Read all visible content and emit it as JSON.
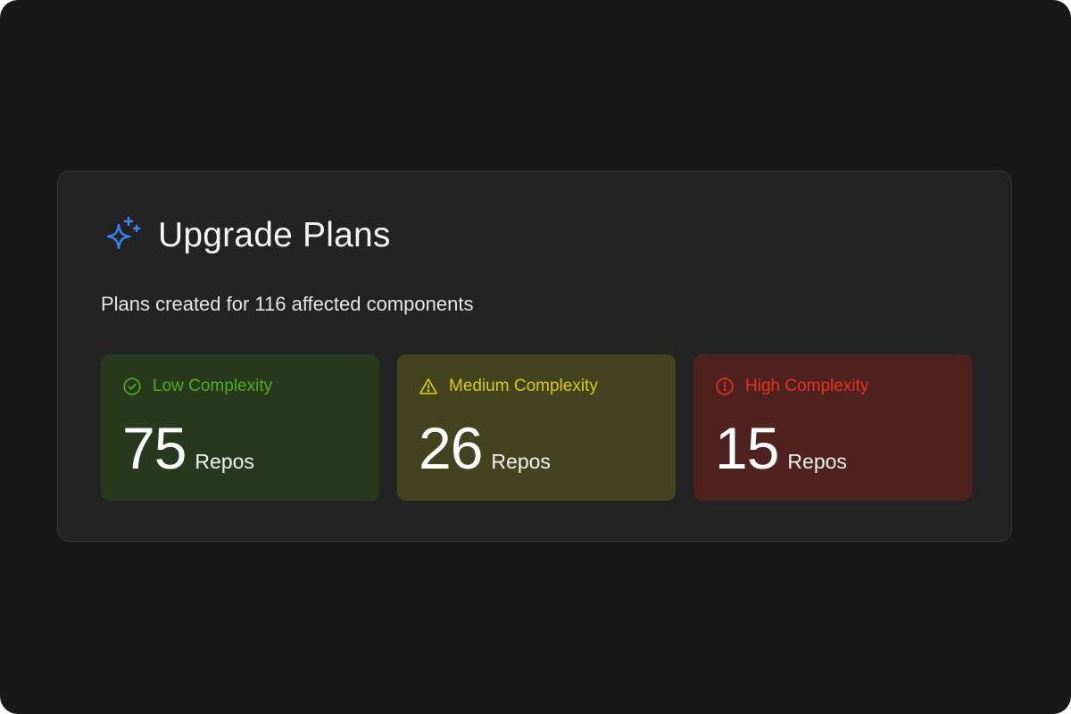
{
  "panel": {
    "title": "Upgrade Plans",
    "subtitle": "Plans created for 116 affected components",
    "icon": "sparkle-icon",
    "accent_color": "#3b82f6"
  },
  "cards": [
    {
      "label": "Low Complexity",
      "count": "75",
      "unit": "Repos",
      "icon": "check-circle-icon",
      "color": "#4caf1f",
      "background": "#29391e"
    },
    {
      "label": "Medium Complexity",
      "count": "26",
      "unit": "Repos",
      "icon": "warning-triangle-icon",
      "color": "#d8c81a",
      "background": "#434320"
    },
    {
      "label": "High Complexity",
      "count": "15",
      "unit": "Repos",
      "icon": "alert-circle-icon",
      "color": "#e8321f",
      "background": "#4f221f"
    }
  ]
}
